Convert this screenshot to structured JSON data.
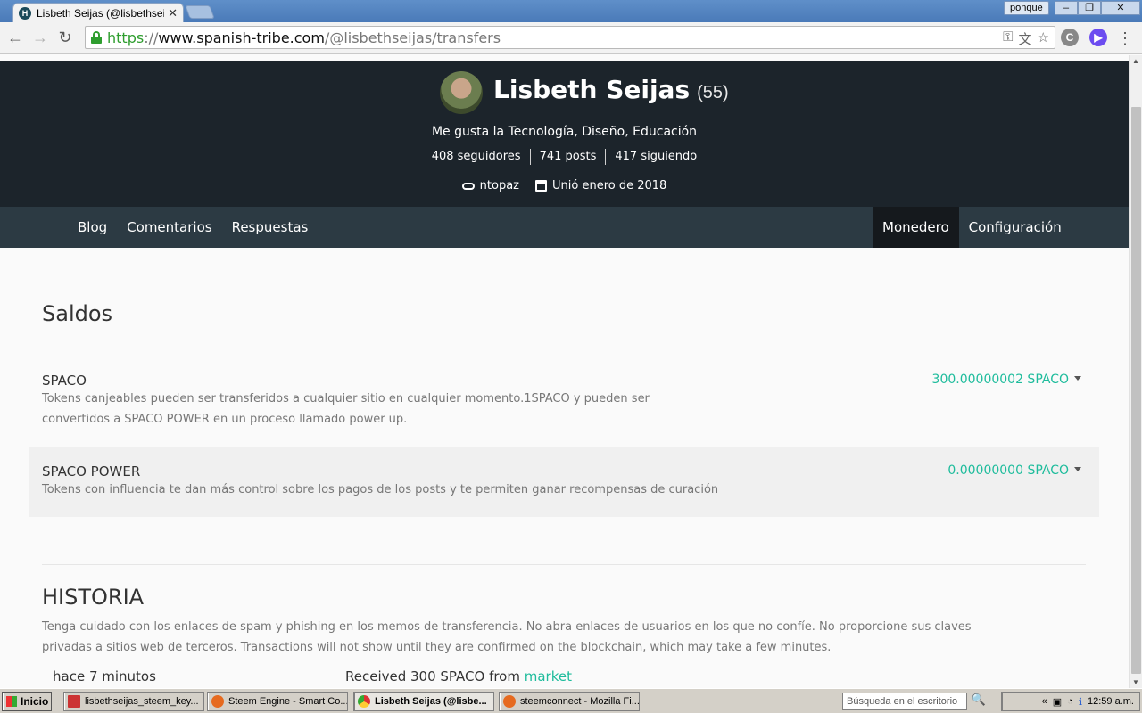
{
  "browser": {
    "tab_title": "Lisbeth Seijas (@lisbethseijas",
    "user_chip": "ponque",
    "url_scheme": "https",
    "url_sep": "://",
    "url_host": "www.spanish-tribe.com",
    "url_path": "/@lisbethseijas/transfers"
  },
  "profile": {
    "name": "Lisbeth Seijas",
    "reputation": "(55)",
    "bio": "Me gusta la Tecnología, Diseño, Educación",
    "followers": "408 seguidores",
    "posts": "741 posts",
    "following": "417 siguiendo",
    "website": "ntopaz",
    "joined": "Unió enero de 2018"
  },
  "nav": {
    "blog": "Blog",
    "comments": "Comentarios",
    "replies": "Respuestas",
    "wallet": "Monedero",
    "settings": "Configuración"
  },
  "wallet": {
    "title": "Saldos",
    "balances": [
      {
        "name": "SPACO",
        "desc": "Tokens canjeables pueden ser transferidos a cualquier sitio en cualquier momento.1SPACO y pueden ser convertidos a SPACO POWER en un proceso llamado power up.",
        "value": "300.00000002 SPACO"
      },
      {
        "name": "SPACO POWER",
        "desc": "Tokens con influencia te dan más control sobre los pagos de los posts y te permiten ganar recompensas de curación",
        "value": "0.00000000 SPACO"
      }
    ]
  },
  "history": {
    "title": "HISTORIA",
    "warning": "Tenga cuidado con los enlaces de spam y phishing en los memos de transferencia. No abra enlaces de usuarios en los que no confíe. No proporcione sus claves privadas a sitios web de terceros. Transactions will not show until they are confirmed on the blockchain, which may take a few minutes.",
    "rows": [
      {
        "time": "hace 7 minutos",
        "desc_prefix": "Received 300 SPACO from ",
        "link": "market"
      }
    ]
  },
  "taskbar": {
    "start": "Inicio",
    "tasks": [
      "lisbethseijas_steem_key...",
      "Steem Engine - Smart Co...",
      "Lisbeth Seijas (@lisbe...",
      "steemconnect - Mozilla Fi..."
    ],
    "search_placeholder": "Búsqueda en el escritorio",
    "clock": "12:59 a.m."
  },
  "colors": {
    "accent": "#1ebc9c",
    "hero_bg": "#1c242b",
    "subnav_bg": "#2c3a43"
  }
}
